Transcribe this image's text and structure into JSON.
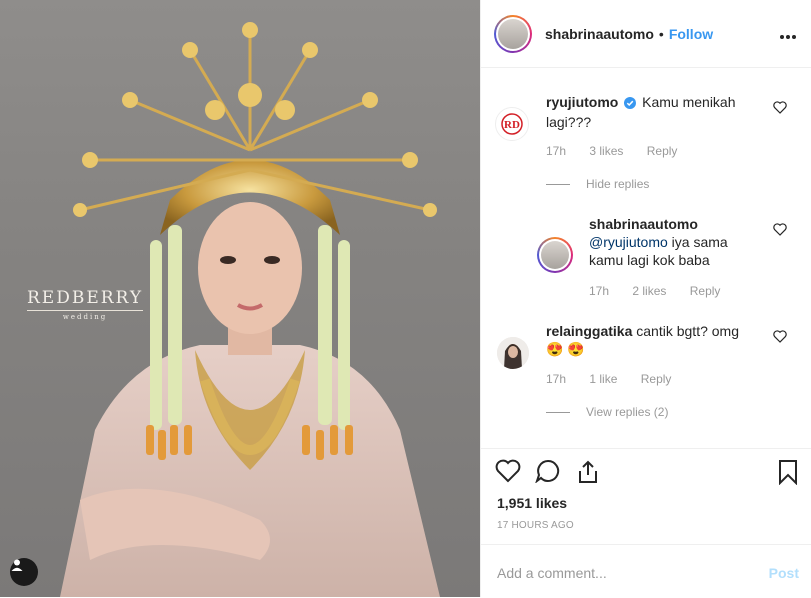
{
  "photo": {
    "watermark_title": "REDBERRY",
    "watermark_sub": "wedding",
    "user_tag_icon": "person-icon"
  },
  "header": {
    "username": "shabrinaautomo",
    "separator": "•",
    "follow_label": "Follow",
    "more_icon": "more-options-icon"
  },
  "comments": [
    {
      "username": "ryujiutomo",
      "verified": true,
      "text": "Kamu menikah lagi???",
      "time": "17h",
      "likes": "3 likes",
      "reply_label": "Reply",
      "toggle_label": "Hide replies"
    },
    {
      "username": "shabrinaautomo",
      "mention": "@ryujiutomo",
      "text": " iya sama kamu lagi kok baba",
      "time": "17h",
      "likes": "2 likes",
      "reply_label": "Reply"
    },
    {
      "username": "relainggatika",
      "text": "cantik bgtt? omg😍 😍",
      "time": "17h",
      "likes": "1 like",
      "reply_label": "Reply",
      "toggle_label": "View replies (2)"
    }
  ],
  "actions": {
    "likes": "1,951 likes",
    "time_ago": "17 HOURS AGO"
  },
  "add_comment": {
    "placeholder": "Add a comment...",
    "post_label": "Post"
  },
  "colors": {
    "accent": "#3897f0",
    "post_disabled": "#b2dffc",
    "muted": "#999999",
    "mention": "#003569"
  }
}
